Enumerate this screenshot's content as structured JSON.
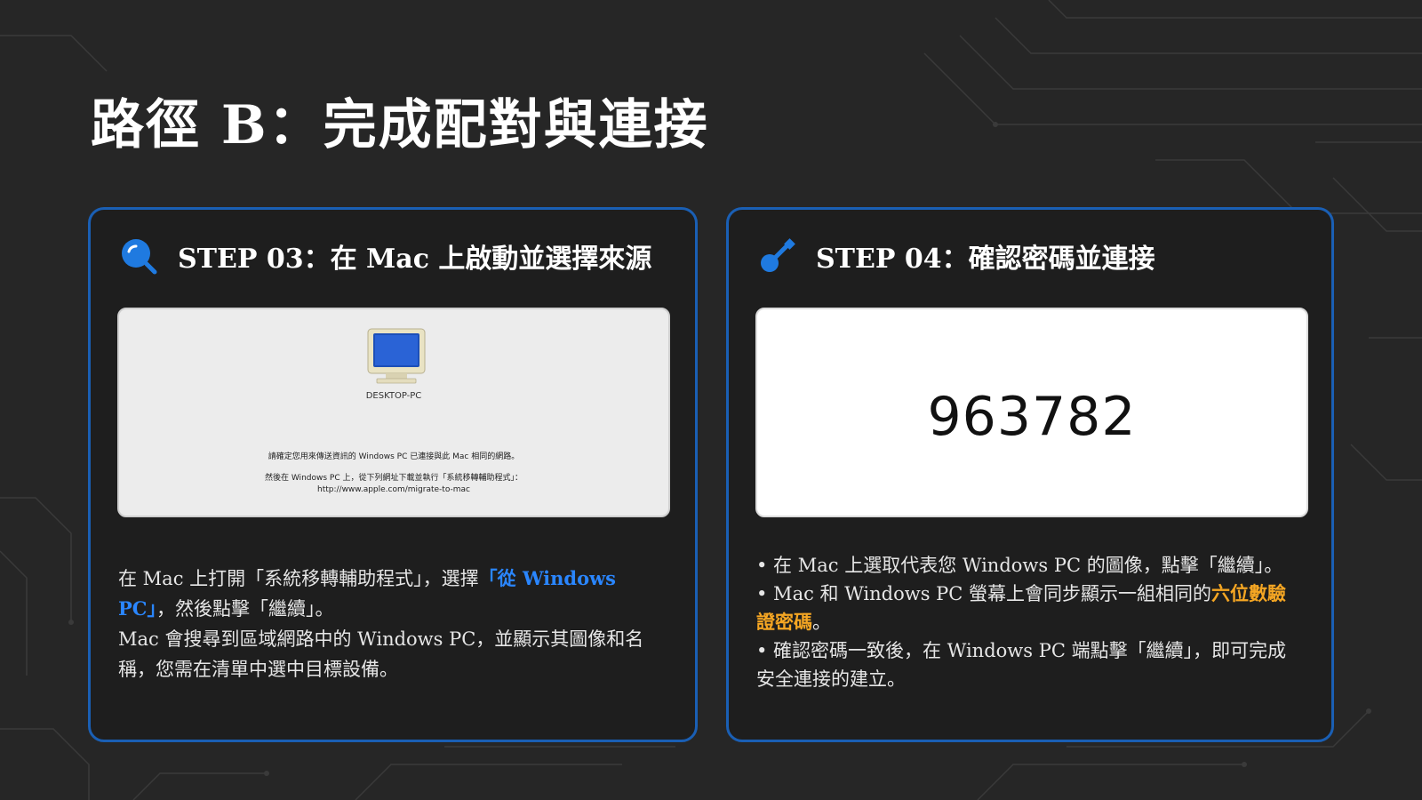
{
  "page": {
    "title": "路徑 B：完成配對與連接"
  },
  "step3": {
    "title": "STEP 03：在 Mac 上啟動並選擇來源",
    "icon": "search-icon",
    "screenshot": {
      "device_name": "DESKTOP-PC",
      "message_1": "請確定您用來傳送資訊的 Windows PC 已連接與此 Mac 相同的網路。",
      "message_2": "然後在 Windows PC 上，從下列網址下載並執行「系統移轉輔助程式」：",
      "message_url": "http://www.apple.com/migrate-to-mac"
    },
    "desc": {
      "part1": "在 Mac 上打開「系統移轉輔助程式」，選擇",
      "highlight": "「從 Windows PC」",
      "part2": "，然後點擊「繼續」。",
      "para2": "Mac 會搜尋到區域網路中的 Windows PC，並顯示其圖像和名稱，您需在清單中選中目標設備。"
    }
  },
  "step4": {
    "title": "STEP 04：確認密碼並連接",
    "icon": "key-icon",
    "code": "963782",
    "bullets": {
      "b1": "• 在 Mac 上選取代表您 Windows PC 的圖像，點擊「繼續」。",
      "b2_part1": "• Mac 和 Windows PC 螢幕上會同步顯示一組相同的",
      "b2_highlight": "六位數驗證密碼",
      "b2_part2": "。",
      "b3": "• 確認密碼一致後，在 Windows PC 端點擊「繼續」，即可完成安全連接的建立。"
    }
  },
  "colors": {
    "accent_blue": "#1a5fb4",
    "highlight_blue": "#2a86ff",
    "highlight_orange": "#f5a623",
    "background": "#262626"
  }
}
